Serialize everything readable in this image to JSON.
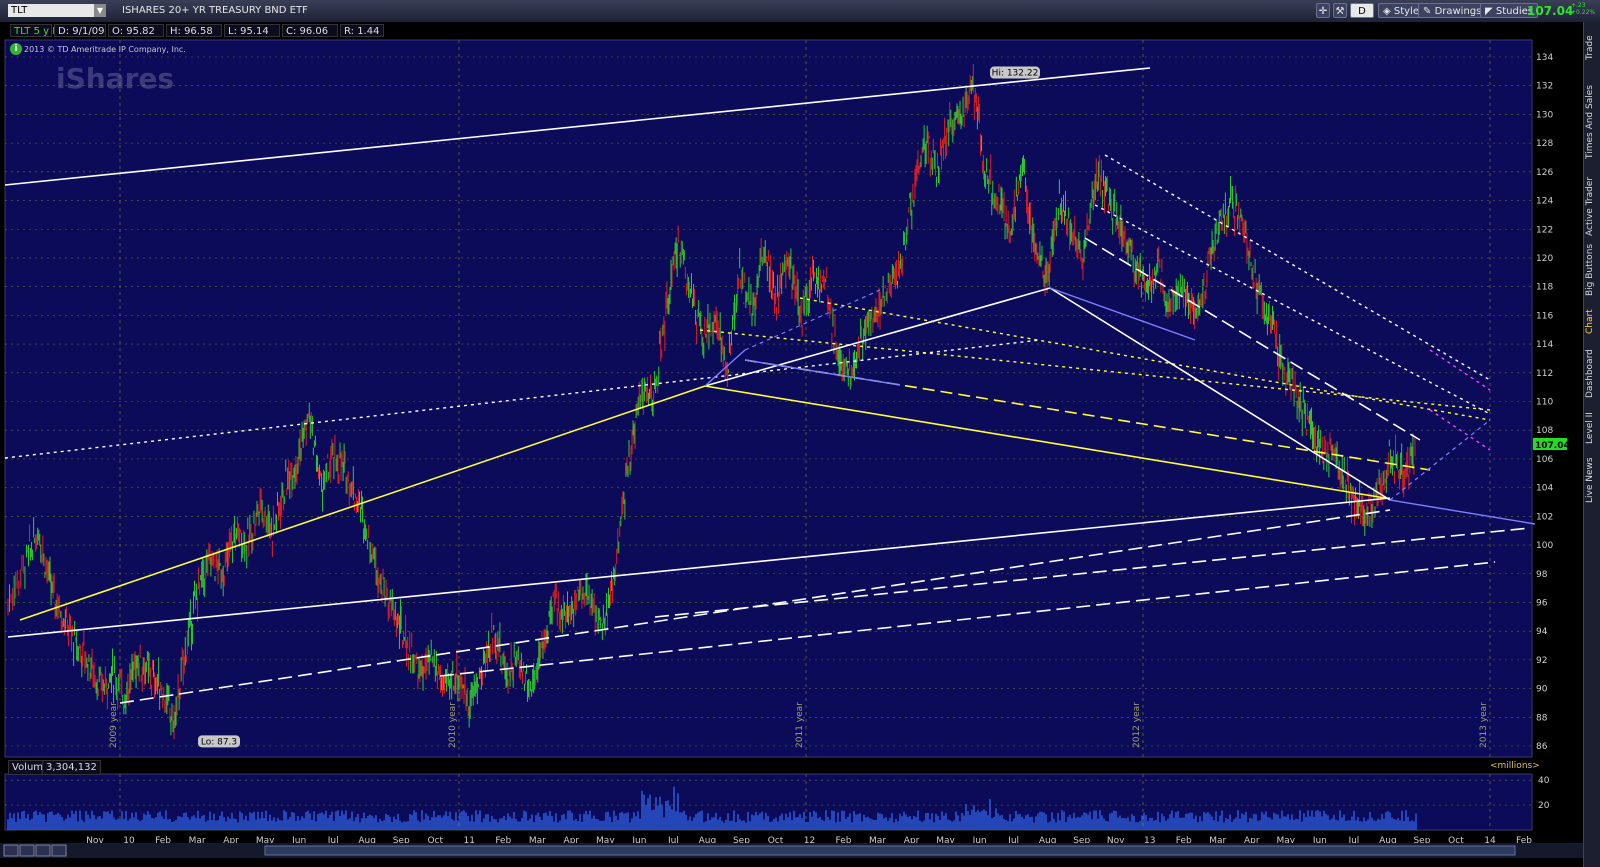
{
  "header": {
    "symbol": "TLT",
    "symbol_name": "ISHARES 20+ YR TREASURY BND ETF",
    "buttons": {
      "d": "D",
      "style": "Style",
      "drawings": "Drawings",
      "studies": "Studies"
    },
    "last_price": "107.04",
    "change_abs": "+.23",
    "change_pct": "+0.22%"
  },
  "info_bar": {
    "period": "TLT 5 y D",
    "date": "D: 9/1/09",
    "open": "O: 95.82",
    "high": "H: 96.58",
    "low": "L: 95.14",
    "close": "C: 96.06",
    "range": "R: 1.44"
  },
  "copyright": "2013 © TD Ameritrade IP Company, Inc.",
  "watermark": "iShares",
  "side_tabs": [
    "Trade",
    "Times And Sales",
    "Active Trader",
    "Big Buttons",
    "Chart",
    "Dashboard",
    "Level II",
    "Live News"
  ],
  "volume": {
    "label": "Volume",
    "value": "3,304,132",
    "unit": "<millions>",
    "ticks": [
      "40",
      "20"
    ]
  },
  "colors": {
    "background": "#000000",
    "plot_background": "#0b0b5a",
    "grid": "#6b6b2a",
    "up_candle": "#2ecc2e",
    "down_candle": "#e02020",
    "trend_white": "#ffffff",
    "trend_yellow": "#ffff3a",
    "trend_blue": "#8080ff",
    "trend_magenta": "#ff40ff",
    "price_tag": "#22dd22",
    "volume_bar": "#2f5fe0"
  },
  "chart_data": {
    "type": "candlestick",
    "title": "ISHARES 20+ YR TREASURY BND ETF",
    "ylim": [
      86,
      135
    ],
    "y_ticks": [
      86,
      88,
      90,
      92,
      94,
      96,
      98,
      100,
      102,
      104,
      106,
      108,
      110,
      112,
      114,
      116,
      118,
      120,
      122,
      124,
      126,
      128,
      130,
      132,
      134
    ],
    "y_tick_labels": [
      "86",
      "88",
      "90",
      "92",
      "94",
      "96",
      "98",
      "100",
      "102",
      "104",
      "106",
      "108",
      "110",
      "112",
      "114",
      "116",
      "118",
      "120",
      "122",
      "124",
      "126",
      "128",
      "130",
      "132",
      "134"
    ],
    "x_tick_labels": [
      "Nov",
      "10",
      "Feb",
      "Mar",
      "Apr",
      "May",
      "Jun",
      "Jul",
      "Aug",
      "Sep",
      "Oct",
      "11",
      "Feb",
      "Mar",
      "Apr",
      "May",
      "Jun",
      "Jul",
      "Aug",
      "Sep",
      "Oct",
      "12",
      "Feb",
      "Mar",
      "Apr",
      "May",
      "Jun",
      "Jul",
      "Aug",
      "Sep",
      "Nov",
      "13",
      "Feb",
      "Mar",
      "Apr",
      "May",
      "Jun",
      "Jul",
      "Aug",
      "Sep",
      "Oct",
      "14",
      "Feb"
    ],
    "year_markers": [
      "2009 year",
      "2010 year",
      "2011 year",
      "2012 year",
      "2013 year"
    ],
    "annotations": {
      "high": "Hi: 132.22",
      "low": "Lo: 87.3"
    },
    "last_price_tag": "107.04",
    "price_path": [
      [
        0,
        96
      ],
      [
        3,
        99
      ],
      [
        5,
        101
      ],
      [
        7,
        97
      ],
      [
        9,
        95
      ],
      [
        11,
        93
      ],
      [
        13,
        92
      ],
      [
        15,
        90
      ],
      [
        17,
        91
      ],
      [
        19,
        89.5
      ],
      [
        21,
        92
      ],
      [
        23,
        91
      ],
      [
        25,
        90
      ],
      [
        27,
        87.5
      ],
      [
        29,
        93
      ],
      [
        31,
        97
      ],
      [
        33,
        99
      ],
      [
        35,
        98
      ],
      [
        37,
        101
      ],
      [
        39,
        100
      ],
      [
        41,
        103
      ],
      [
        43,
        101
      ],
      [
        45,
        104
      ],
      [
        47,
        106
      ],
      [
        49,
        109
      ],
      [
        51,
        104
      ],
      [
        53,
        106
      ],
      [
        55,
        105
      ],
      [
        57,
        103
      ],
      [
        59,
        100
      ],
      [
        61,
        97
      ],
      [
        63,
        95
      ],
      [
        65,
        93
      ],
      [
        67,
        91
      ],
      [
        69,
        92
      ],
      [
        71,
        90
      ],
      [
        73,
        91
      ],
      [
        75,
        89
      ],
      [
        77,
        91
      ],
      [
        79,
        94
      ],
      [
        81,
        91
      ],
      [
        83,
        92
      ],
      [
        85,
        90
      ],
      [
        87,
        93
      ],
      [
        89,
        96
      ],
      [
        91,
        95
      ],
      [
        93,
        97
      ],
      [
        95,
        96
      ],
      [
        97,
        94
      ],
      [
        99,
        99
      ],
      [
        101,
        106
      ],
      [
        103,
        111
      ],
      [
        105,
        110
      ],
      [
        107,
        116
      ],
      [
        109,
        121
      ],
      [
        111,
        118
      ],
      [
        113,
        114
      ],
      [
        115,
        116
      ],
      [
        117,
        112
      ],
      [
        119,
        119
      ],
      [
        121,
        116
      ],
      [
        123,
        121
      ],
      [
        125,
        117
      ],
      [
        127,
        120
      ],
      [
        129,
        116
      ],
      [
        131,
        119
      ],
      [
        133,
        118
      ],
      [
        135,
        113
      ],
      [
        137,
        112
      ],
      [
        139,
        115
      ],
      [
        141,
        116
      ],
      [
        143,
        118
      ],
      [
        145,
        119
      ],
      [
        147,
        124
      ],
      [
        149,
        128
      ],
      [
        151,
        126
      ],
      [
        153,
        129
      ],
      [
        155,
        130
      ],
      [
        157,
        132
      ],
      [
        159,
        126
      ],
      [
        161,
        124
      ],
      [
        163,
        122
      ],
      [
        165,
        126
      ],
      [
        167,
        121
      ],
      [
        169,
        119
      ],
      [
        171,
        124
      ],
      [
        173,
        122
      ],
      [
        175,
        120
      ],
      [
        177,
        126
      ],
      [
        179,
        124
      ],
      [
        181,
        122
      ],
      [
        183,
        120
      ],
      [
        185,
        118
      ],
      [
        187,
        119
      ],
      [
        189,
        117
      ],
      [
        191,
        118
      ],
      [
        193,
        116
      ],
      [
        195,
        119
      ],
      [
        197,
        122
      ],
      [
        199,
        124
      ],
      [
        201,
        122
      ],
      [
        203,
        118
      ],
      [
        205,
        116
      ],
      [
        207,
        113
      ],
      [
        209,
        111
      ],
      [
        211,
        109
      ],
      [
        213,
        107
      ],
      [
        215,
        106
      ],
      [
        217,
        105
      ],
      [
        219,
        103
      ],
      [
        221,
        102
      ],
      [
        223,
        104
      ],
      [
        225,
        106
      ],
      [
        227,
        105
      ],
      [
        229,
        107
      ]
    ]
  }
}
